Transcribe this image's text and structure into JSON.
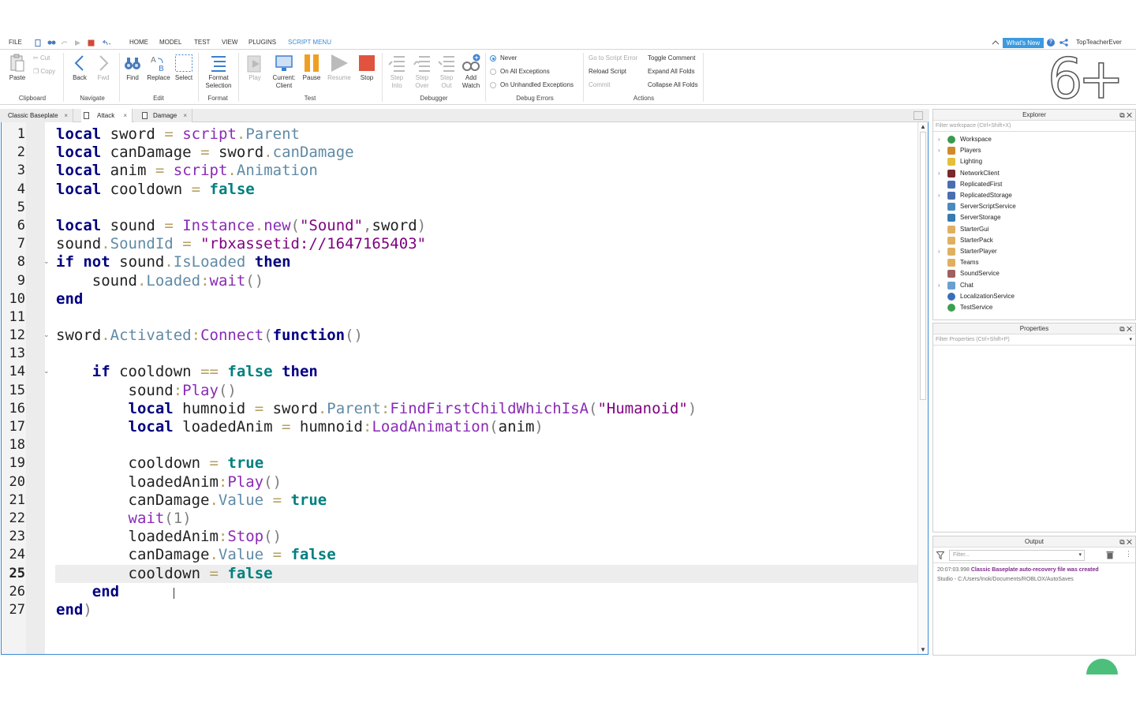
{
  "menubar": {
    "tabs": [
      "FILE",
      "HOME",
      "MODEL",
      "TEST",
      "VIEW",
      "PLUGINS",
      "SCRIPT MENU"
    ],
    "active_tab": "SCRIPT MENU",
    "whats_new": "What's New",
    "help": "?",
    "username": "TopTeacherEver"
  },
  "ribbon": {
    "clipboard": {
      "paste": "Paste",
      "cut": "Cut",
      "copy": "Copy",
      "label": "Clipboard"
    },
    "navigate": {
      "back": "Back",
      "fwd": "Fwd",
      "label": "Navigate"
    },
    "edit": {
      "find": "Find",
      "replace": "Replace",
      "select": "Select",
      "label": "Edit"
    },
    "format": {
      "format_selection_1": "Format",
      "format_selection_2": "Selection",
      "label": "Format"
    },
    "test": {
      "play": "Play",
      "current_client_1": "Current:",
      "current_client_2": "Client",
      "pause": "Pause",
      "resume": "Resume",
      "stop": "Stop",
      "label": "Test"
    },
    "debugger": {
      "step_into_1": "Step",
      "step_into_2": "Into",
      "step_over_1": "Step",
      "step_over_2": "Over",
      "step_out_1": "Step",
      "step_out_2": "Out",
      "add_watch_1": "Add",
      "add_watch_2": "Watch",
      "label": "Debugger"
    },
    "debug_errors": {
      "never": "Never",
      "all": "On All Exceptions",
      "unhandled": "On Unhandled Exceptions",
      "label": "Debug Errors",
      "selected": "Never"
    },
    "actions": {
      "goto_error": "Go to Script Error",
      "reload": "Reload Script",
      "commit": "Commit",
      "toggle_comment": "Toggle Comment",
      "expand_folds": "Expand All Folds",
      "collapse_folds": "Collapse All Folds",
      "label": "Actions"
    },
    "badge": "6+"
  },
  "tabs": [
    {
      "label": "Classic Baseplate",
      "close": "×"
    },
    {
      "label": "Attack",
      "close": "×"
    },
    {
      "label": "Damage",
      "close": "×"
    }
  ],
  "active_tab": "Attack",
  "editor": {
    "current_line": 25,
    "line_numbers": [
      "1",
      "2",
      "3",
      "4",
      "5",
      "6",
      "7",
      "8",
      "9",
      "10",
      "11",
      "12",
      "13",
      "14",
      "15",
      "16",
      "17",
      "18",
      "19",
      "20",
      "21",
      "22",
      "23",
      "24",
      "25",
      "26",
      "27"
    ],
    "lines": [
      "local sword = script.Parent",
      "local canDamage = sword.canDamage",
      "local anim = script.Animation",
      "local cooldown = false",
      "",
      "local sound = Instance.new(\"Sound\",sword)",
      "sound.SoundId = \"rbxassetid://1647165403\"",
      "if not sound.IsLoaded then",
      "    sound.Loaded:wait()",
      "end",
      "",
      "sword.Activated:Connect(function()",
      "",
      "    if cooldown == false then",
      "        sound:Play()",
      "        local humnoid = sword.Parent:FindFirstChildWhichIsA(\"Humanoid\")",
      "        local loadedAnim = humnoid:LoadAnimation(anim)",
      "",
      "        cooldown = true",
      "        loadedAnim:Play()",
      "        canDamage.Value = true",
      "        wait(1)",
      "        loadedAnim:Stop()",
      "        canDamage.Value = false",
      "        cooldown = false",
      "    end",
      "end)"
    ],
    "tokens": {
      "local": "local",
      "sword": "sword",
      "script": "script",
      "parent": "Parent",
      "canDamage": "canDamage",
      "anim": "anim",
      "animation": "Animation",
      "cooldown": "cooldown",
      "false": "false",
      "true": "true",
      "sound": "sound",
      "instance": "Instance",
      "new": "new",
      "str_sound": "\"Sound\"",
      "soundid": "SoundId",
      "str_asset": "\"rbxassetid://1647165403\"",
      "if": "if",
      "not": "not",
      "isloaded": "IsLoaded",
      "then": "then",
      "loaded": "Loaded",
      "wait": "wait",
      "end": "end",
      "activated": "Activated",
      "connect": "Connect",
      "function": "function",
      "play": "Play",
      "humnoid": "humnoid",
      "ffcwia": "FindFirstChildWhichIsA",
      "str_humanoid": "\"Humanoid\"",
      "loadedAnim": "loadedAnim",
      "loadanimation": "LoadAnimation",
      "value": "Value",
      "one": "1",
      "stop": "Stop"
    }
  },
  "explorer": {
    "title": "Explorer",
    "filter_placeholder": "Filter workspace (Ctrl+Shift+X)",
    "items": [
      {
        "label": "Workspace",
        "icon": "globe-icon",
        "expandable": true,
        "color": "#3a9a4e"
      },
      {
        "label": "Players",
        "icon": "players-icon",
        "expandable": true,
        "color": "#d08a2a"
      },
      {
        "label": "Lighting",
        "icon": "bulb-icon",
        "expandable": false,
        "color": "#e4c03a"
      },
      {
        "label": "NetworkClient",
        "icon": "network-icon",
        "expandable": true,
        "color": "#7a2a2a"
      },
      {
        "label": "ReplicatedFirst",
        "icon": "replicated-icon",
        "expandable": false,
        "color": "#4a6fb0"
      },
      {
        "label": "ReplicatedStorage",
        "icon": "replicated-icon",
        "expandable": true,
        "color": "#4a6fb0"
      },
      {
        "label": "ServerScriptService",
        "icon": "gear-icon",
        "expandable": false,
        "color": "#4a8ac0"
      },
      {
        "label": "ServerStorage",
        "icon": "storage-icon",
        "expandable": false,
        "color": "#3a7ab0"
      },
      {
        "label": "StarterGui",
        "icon": "gui-icon",
        "expandable": false,
        "color": "#e0b060"
      },
      {
        "label": "StarterPack",
        "icon": "pack-icon",
        "expandable": false,
        "color": "#e0b060"
      },
      {
        "label": "StarterPlayer",
        "icon": "player-icon",
        "expandable": true,
        "color": "#e0b060"
      },
      {
        "label": "Teams",
        "icon": "teams-icon",
        "expandable": false,
        "color": "#e0b060"
      },
      {
        "label": "SoundService",
        "icon": "sound-icon",
        "expandable": false,
        "color": "#a06060"
      },
      {
        "label": "Chat",
        "icon": "chat-icon",
        "expandable": true,
        "color": "#6aa0d0"
      },
      {
        "label": "LocalizationService",
        "icon": "globe-icon",
        "expandable": false,
        "color": "#3a6fb8"
      },
      {
        "label": "TestService",
        "icon": "check-icon",
        "expandable": false,
        "color": "#3aa050"
      }
    ]
  },
  "properties": {
    "title": "Properties",
    "filter_placeholder": "Filter Properties (Ctrl+Shift+P)"
  },
  "output": {
    "title": "Output",
    "filter_placeholder": "Filter...",
    "timestamp": "20:07:03.998",
    "message": "Classic Baseplate auto-recovery file was created",
    "path": "Studio - C:/Users/Inok/Documents/ROBLOX/AutoSaves"
  }
}
